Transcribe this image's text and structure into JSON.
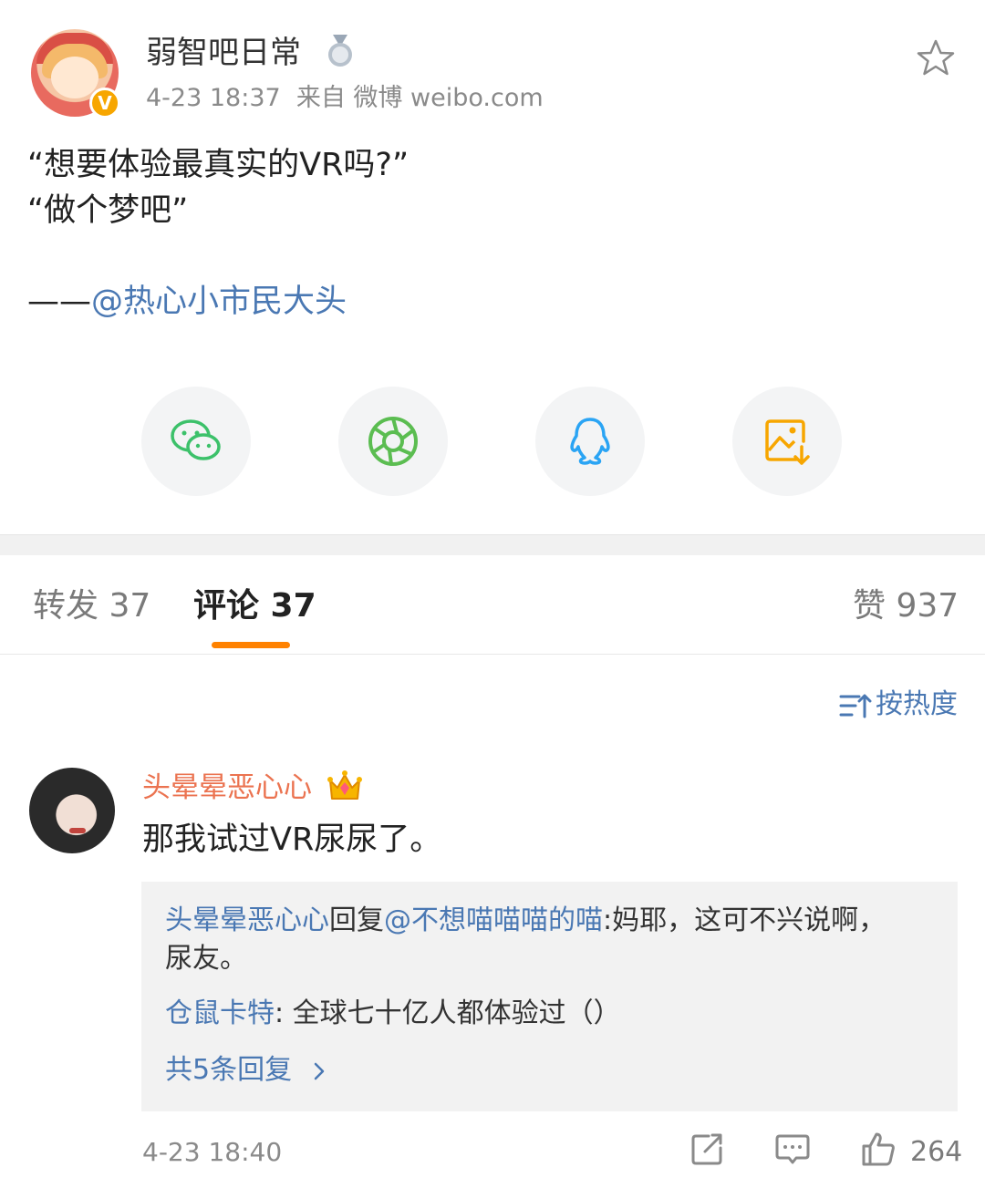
{
  "post": {
    "author": "弱智吧日常",
    "time": "4-23 18:37",
    "source": "来自 微博 weibo.com",
    "line1": "“想要体验最真实的VR吗?”",
    "line2": "“做个梦吧”",
    "sign_prefix": "——",
    "sign_mention": "@热心小市民大头",
    "verify_mark": "V"
  },
  "share": {
    "items": [
      "wechat-icon",
      "moments-icon",
      "qq-icon",
      "save-image-icon"
    ]
  },
  "tabs": {
    "repost": "转发 37",
    "comments": "评论 37",
    "likes": "赞 937"
  },
  "sort": {
    "label": "按热度"
  },
  "comment": {
    "user": "头晕晕恶心心",
    "text": "那我试过VR尿尿了。",
    "reply1_user": "头晕晕恶心心",
    "reply1_mid": "回复",
    "reply1_target": "@不想喵喵喵的喵",
    "reply1_text": ":妈耶，这可不兴说啊，",
    "reply1_text2": "尿友。",
    "reply2_user": "仓鼠卡特",
    "reply2_text": ": 全球七十亿人都体验过（）",
    "more_replies": "共5条回复",
    "time": "4-23 18:40",
    "likes": "264"
  },
  "colors": {
    "accent": "#ff8200",
    "link": "#4a78b3",
    "username_orange": "#eb7350",
    "gray_text": "#8a8a8a"
  }
}
